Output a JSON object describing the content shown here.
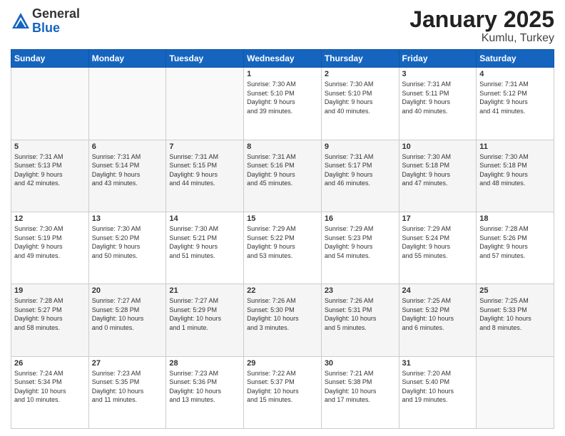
{
  "header": {
    "logo_general": "General",
    "logo_blue": "Blue",
    "title": "January 2025",
    "subtitle": "Kumlu, Turkey"
  },
  "days_of_week": [
    "Sunday",
    "Monday",
    "Tuesday",
    "Wednesday",
    "Thursday",
    "Friday",
    "Saturday"
  ],
  "weeks": [
    [
      {
        "day": "",
        "content": ""
      },
      {
        "day": "",
        "content": ""
      },
      {
        "day": "",
        "content": ""
      },
      {
        "day": "1",
        "content": "Sunrise: 7:30 AM\nSunset: 5:10 PM\nDaylight: 9 hours\nand 39 minutes."
      },
      {
        "day": "2",
        "content": "Sunrise: 7:30 AM\nSunset: 5:10 PM\nDaylight: 9 hours\nand 40 minutes."
      },
      {
        "day": "3",
        "content": "Sunrise: 7:31 AM\nSunset: 5:11 PM\nDaylight: 9 hours\nand 40 minutes."
      },
      {
        "day": "4",
        "content": "Sunrise: 7:31 AM\nSunset: 5:12 PM\nDaylight: 9 hours\nand 41 minutes."
      }
    ],
    [
      {
        "day": "5",
        "content": "Sunrise: 7:31 AM\nSunset: 5:13 PM\nDaylight: 9 hours\nand 42 minutes."
      },
      {
        "day": "6",
        "content": "Sunrise: 7:31 AM\nSunset: 5:14 PM\nDaylight: 9 hours\nand 43 minutes."
      },
      {
        "day": "7",
        "content": "Sunrise: 7:31 AM\nSunset: 5:15 PM\nDaylight: 9 hours\nand 44 minutes."
      },
      {
        "day": "8",
        "content": "Sunrise: 7:31 AM\nSunset: 5:16 PM\nDaylight: 9 hours\nand 45 minutes."
      },
      {
        "day": "9",
        "content": "Sunrise: 7:31 AM\nSunset: 5:17 PM\nDaylight: 9 hours\nand 46 minutes."
      },
      {
        "day": "10",
        "content": "Sunrise: 7:30 AM\nSunset: 5:18 PM\nDaylight: 9 hours\nand 47 minutes."
      },
      {
        "day": "11",
        "content": "Sunrise: 7:30 AM\nSunset: 5:18 PM\nDaylight: 9 hours\nand 48 minutes."
      }
    ],
    [
      {
        "day": "12",
        "content": "Sunrise: 7:30 AM\nSunset: 5:19 PM\nDaylight: 9 hours\nand 49 minutes."
      },
      {
        "day": "13",
        "content": "Sunrise: 7:30 AM\nSunset: 5:20 PM\nDaylight: 9 hours\nand 50 minutes."
      },
      {
        "day": "14",
        "content": "Sunrise: 7:30 AM\nSunset: 5:21 PM\nDaylight: 9 hours\nand 51 minutes."
      },
      {
        "day": "15",
        "content": "Sunrise: 7:29 AM\nSunset: 5:22 PM\nDaylight: 9 hours\nand 53 minutes."
      },
      {
        "day": "16",
        "content": "Sunrise: 7:29 AM\nSunset: 5:23 PM\nDaylight: 9 hours\nand 54 minutes."
      },
      {
        "day": "17",
        "content": "Sunrise: 7:29 AM\nSunset: 5:24 PM\nDaylight: 9 hours\nand 55 minutes."
      },
      {
        "day": "18",
        "content": "Sunrise: 7:28 AM\nSunset: 5:26 PM\nDaylight: 9 hours\nand 57 minutes."
      }
    ],
    [
      {
        "day": "19",
        "content": "Sunrise: 7:28 AM\nSunset: 5:27 PM\nDaylight: 9 hours\nand 58 minutes."
      },
      {
        "day": "20",
        "content": "Sunrise: 7:27 AM\nSunset: 5:28 PM\nDaylight: 10 hours\nand 0 minutes."
      },
      {
        "day": "21",
        "content": "Sunrise: 7:27 AM\nSunset: 5:29 PM\nDaylight: 10 hours\nand 1 minute."
      },
      {
        "day": "22",
        "content": "Sunrise: 7:26 AM\nSunset: 5:30 PM\nDaylight: 10 hours\nand 3 minutes."
      },
      {
        "day": "23",
        "content": "Sunrise: 7:26 AM\nSunset: 5:31 PM\nDaylight: 10 hours\nand 5 minutes."
      },
      {
        "day": "24",
        "content": "Sunrise: 7:25 AM\nSunset: 5:32 PM\nDaylight: 10 hours\nand 6 minutes."
      },
      {
        "day": "25",
        "content": "Sunrise: 7:25 AM\nSunset: 5:33 PM\nDaylight: 10 hours\nand 8 minutes."
      }
    ],
    [
      {
        "day": "26",
        "content": "Sunrise: 7:24 AM\nSunset: 5:34 PM\nDaylight: 10 hours\nand 10 minutes."
      },
      {
        "day": "27",
        "content": "Sunrise: 7:23 AM\nSunset: 5:35 PM\nDaylight: 10 hours\nand 11 minutes."
      },
      {
        "day": "28",
        "content": "Sunrise: 7:23 AM\nSunset: 5:36 PM\nDaylight: 10 hours\nand 13 minutes."
      },
      {
        "day": "29",
        "content": "Sunrise: 7:22 AM\nSunset: 5:37 PM\nDaylight: 10 hours\nand 15 minutes."
      },
      {
        "day": "30",
        "content": "Sunrise: 7:21 AM\nSunset: 5:38 PM\nDaylight: 10 hours\nand 17 minutes."
      },
      {
        "day": "31",
        "content": "Sunrise: 7:20 AM\nSunset: 5:40 PM\nDaylight: 10 hours\nand 19 minutes."
      },
      {
        "day": "",
        "content": ""
      }
    ]
  ]
}
